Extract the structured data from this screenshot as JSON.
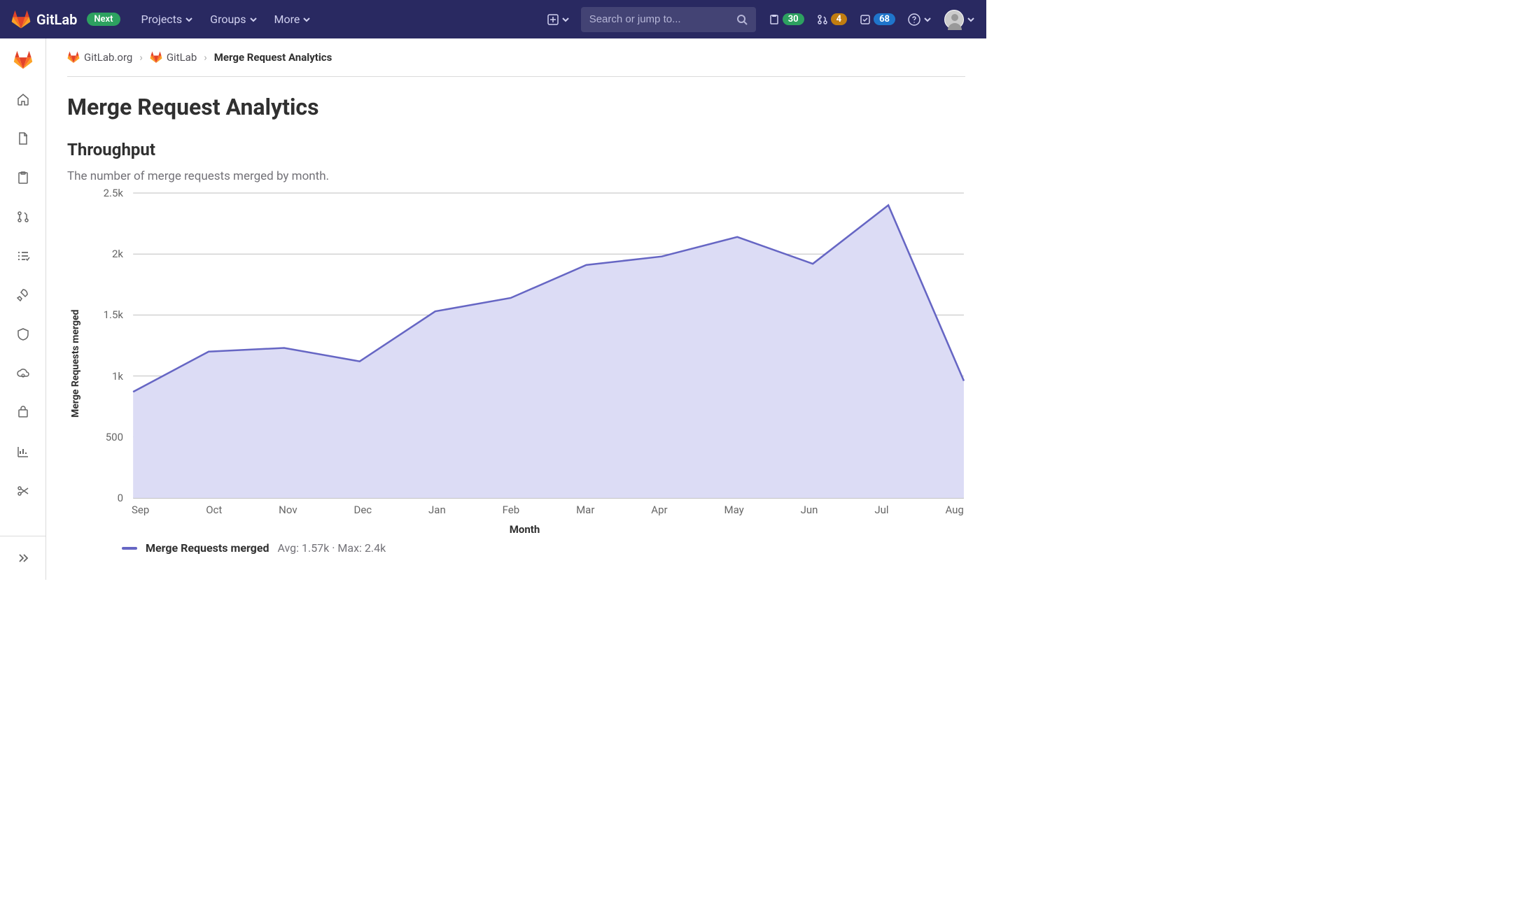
{
  "navbar": {
    "brand": "GitLab",
    "next_badge": "Next",
    "links": {
      "projects": "Projects",
      "groups": "Groups",
      "more": "More"
    },
    "search_placeholder": "Search or jump to...",
    "counts": {
      "issues": "30",
      "merge_requests": "4",
      "todos": "68"
    }
  },
  "breadcrumbs": {
    "org": "GitLab.org",
    "project": "GitLab",
    "current": "Merge Request Analytics"
  },
  "page": {
    "title": "Merge Request Analytics",
    "section_title": "Throughput",
    "section_desc": "The number of merge requests merged by month."
  },
  "chart_data": {
    "type": "area",
    "title": "Throughput",
    "xlabel": "Month",
    "ylabel": "Merge Requests merged",
    "ylim": [
      0,
      2500
    ],
    "yticks": [
      0,
      500,
      1000,
      1500,
      2000,
      2500
    ],
    "ytick_labels": [
      "0",
      "500",
      "1k",
      "1.5k",
      "2k",
      "2.5k"
    ],
    "categories": [
      "Sep",
      "Oct",
      "Nov",
      "Dec",
      "Jan",
      "Feb",
      "Mar",
      "Apr",
      "May",
      "Jun",
      "Jul",
      "Aug"
    ],
    "series": [
      {
        "name": "Merge Requests merged",
        "values": [
          870,
          1200,
          1230,
          1120,
          1530,
          1640,
          1910,
          1980,
          2140,
          1920,
          2400,
          960
        ]
      }
    ],
    "legend": {
      "series_label": "Merge Requests merged",
      "stats": "Avg: 1.57k · Max: 2.4k"
    }
  }
}
